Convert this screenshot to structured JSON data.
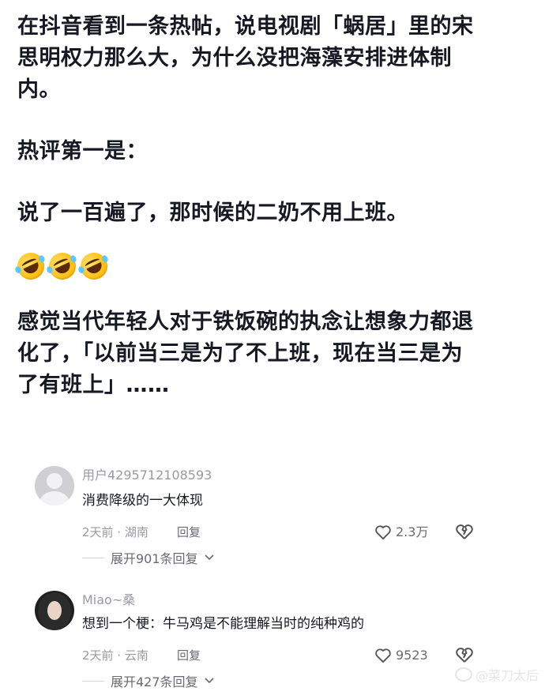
{
  "post": {
    "paragraph1_line1": "在抖音看到一条热帖，说电视剧「蜗居」里的宋",
    "paragraph1_line2": "思明权力那么大，为什么没把海藻安排进体制",
    "paragraph1_line3": "内。",
    "paragraph2": "热评第一是：",
    "paragraph3": "说了一百遍了，那时候的二奶不用上班。",
    "emoji": "rolling-on-floor-laughing",
    "paragraph4_line1": "感觉当代年轻人对于铁饭碗的执念让想象力都退",
    "paragraph4_line2": "化了，「以前当三是为了不上班，现在当三是为",
    "paragraph4_line3": "了有班上」……"
  },
  "comments": [
    {
      "username": "用户4295712108593",
      "text": "消费降级的一大体现",
      "time_location": "2天前 · 湖南",
      "reply_label": "回复",
      "likes": "2.3万",
      "expand_label": "展开901条回复",
      "avatar": "default-gray-avatar"
    },
    {
      "username": "Miao~桑",
      "text": "想到一个梗：牛马鸡是不能理解当时的纯种鸡的",
      "time_location": "2天前 · 云南",
      "reply_label": "回复",
      "likes": "9523",
      "expand_label": "展开427条回复",
      "avatar": "photo-avatar"
    }
  ],
  "watermark": "@菜刀太后",
  "colors": {
    "text": "#161823",
    "meta": "#9a9aa0",
    "emoji": "#ffc21a"
  }
}
